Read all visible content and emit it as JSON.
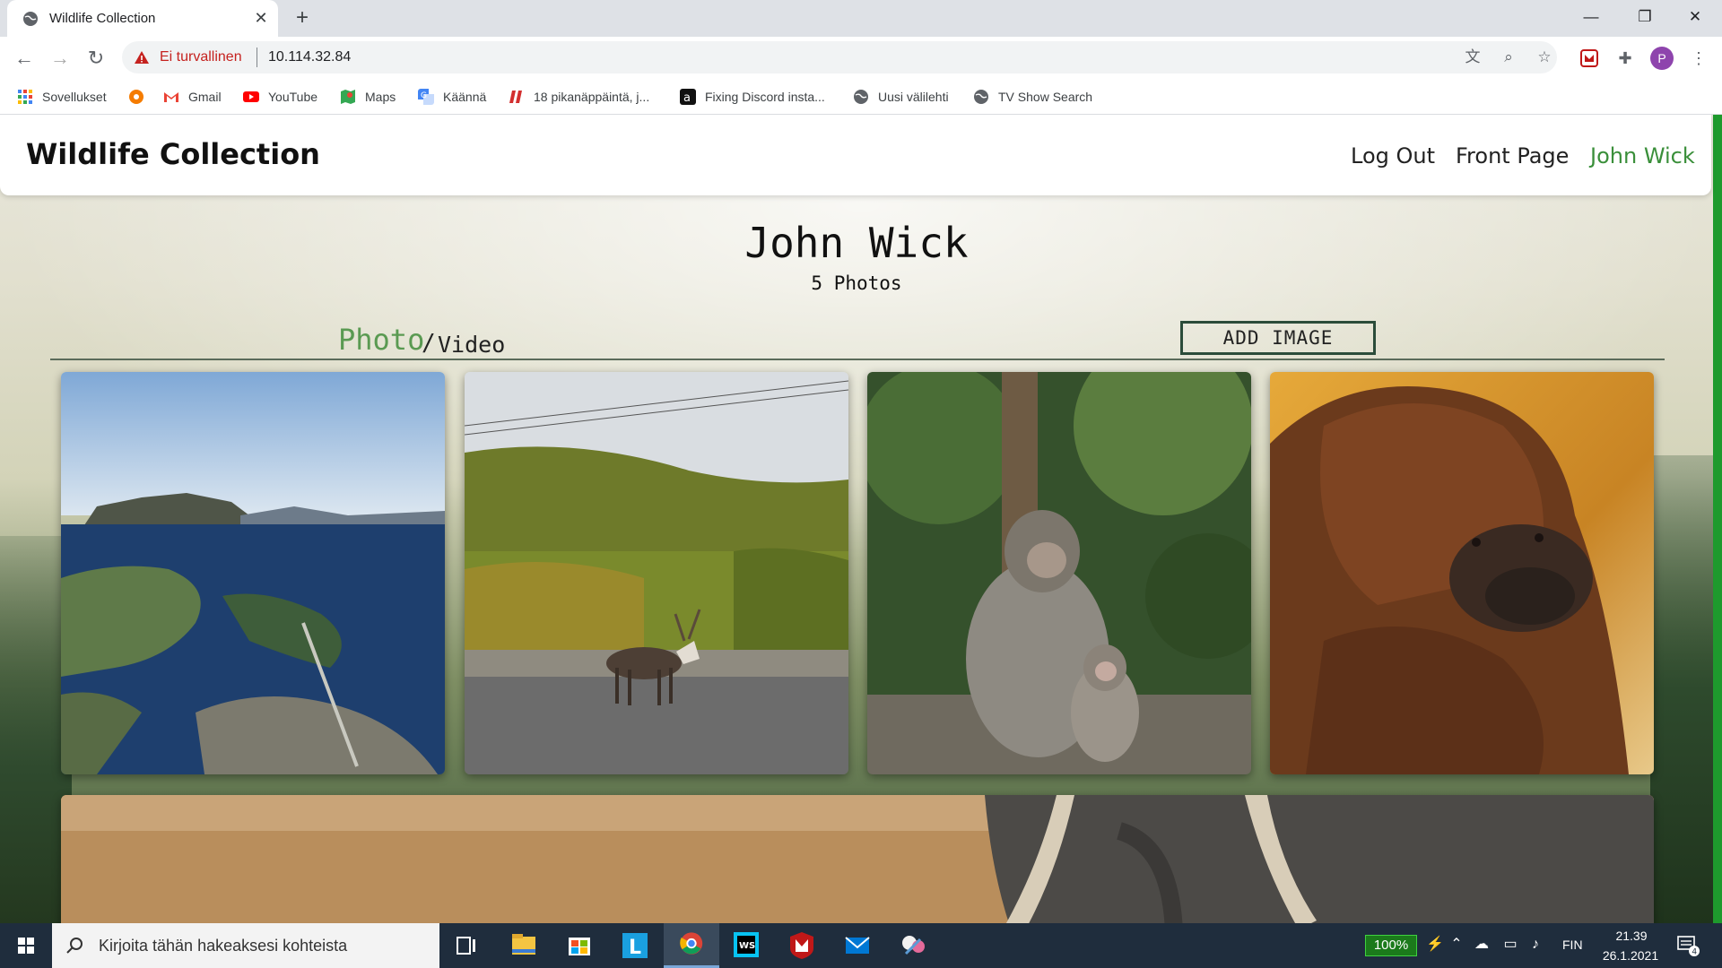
{
  "browser": {
    "tab_title": "Wildlife Collection",
    "close_glyph": "✕",
    "new_tab_glyph": "+",
    "window_controls": {
      "minimize": "—",
      "maximize": "❐",
      "close": "✕"
    },
    "security_label": "Ei turvallinen",
    "url": "10.114.32.84",
    "nav": {
      "back": "←",
      "forward": "→",
      "reload": "↻"
    },
    "bookmarks": [
      {
        "label": "Sovellukset",
        "color": "#4285f4"
      },
      {
        "label": "",
        "color": "#f57c00"
      },
      {
        "label": "Gmail",
        "color": "#ea4335"
      },
      {
        "label": "YouTube",
        "color": "#ff0000"
      },
      {
        "label": "Maps",
        "color": "#34a853"
      },
      {
        "label": "Käännä",
        "color": "#4285f4"
      },
      {
        "label": "18 pikanäppäintä, j...",
        "color": "#d32f2f"
      },
      {
        "label": "Fixing Discord insta...",
        "color": "#111111"
      },
      {
        "label": "Uusi välilehti",
        "color": "#5f6368"
      },
      {
        "label": "TV Show Search",
        "color": "#5f6368"
      }
    ],
    "profile_initial": "P"
  },
  "site": {
    "title": "Wildlife Collection",
    "nav": [
      {
        "label": "Log Out",
        "active": false
      },
      {
        "label": "Front Page",
        "active": false
      },
      {
        "label": "John Wick",
        "active": true
      }
    ],
    "profile_name": "John Wick",
    "photo_count": "5 Photos",
    "tabs": {
      "photo": "Photo",
      "separator": "/",
      "video": "Video"
    },
    "add_image_label": "ADD IMAGE",
    "accent_color": "#5a9a52",
    "gallery": [
      {
        "subject": "coastal fjord landscape"
      },
      {
        "subject": "reindeer on road"
      },
      {
        "subject": "macaque with baby"
      },
      {
        "subject": "gorilla portrait"
      },
      {
        "subject": "elephant"
      }
    ]
  },
  "taskbar": {
    "search_placeholder": "Kirjoita tähän hakeaksesi kohteista",
    "battery": "100%",
    "language": "FIN",
    "time": "21.39",
    "date": "26.1.2021",
    "notification_count": "4"
  }
}
